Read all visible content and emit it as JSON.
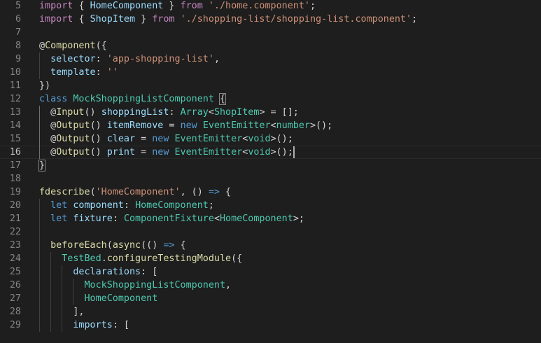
{
  "theme": {
    "keyword": "#569cd6",
    "control": "#c586c0",
    "string": "#ce9178",
    "variable": "#9cdcfe",
    "type": "#4ec9b0",
    "function": "#dcdcaa",
    "text": "#d4d4d4"
  },
  "editor": {
    "active_line": 16,
    "lines": [
      {
        "num": 5,
        "tokens": [
          [
            "import ",
            "control"
          ],
          [
            "{ ",
            "text"
          ],
          [
            "HomeComponent",
            "variable"
          ],
          [
            " } ",
            "text"
          ],
          [
            "from ",
            "control"
          ],
          [
            "'./home.component'",
            "string"
          ],
          [
            ";",
            "text"
          ]
        ]
      },
      {
        "num": 6,
        "tokens": [
          [
            "import ",
            "control"
          ],
          [
            "{ ",
            "text"
          ],
          [
            "ShopItem",
            "variable"
          ],
          [
            " } ",
            "text"
          ],
          [
            "from ",
            "control"
          ],
          [
            "'./shopping-list/shopping-list.component'",
            "string"
          ],
          [
            ";",
            "text"
          ]
        ]
      },
      {
        "num": 7,
        "tokens": []
      },
      {
        "num": 8,
        "tokens": [
          [
            "@",
            "text"
          ],
          [
            "Component",
            "function"
          ],
          [
            "({",
            "text"
          ]
        ]
      },
      {
        "num": 9,
        "tokens": [
          [
            "  ",
            "text"
          ],
          [
            "selector",
            "variable"
          ],
          [
            ": ",
            "text"
          ],
          [
            "'app-shopping-list'",
            "string"
          ],
          [
            ",",
            "text"
          ]
        ]
      },
      {
        "num": 10,
        "tokens": [
          [
            "  ",
            "text"
          ],
          [
            "template",
            "variable"
          ],
          [
            ": ",
            "text"
          ],
          [
            "''",
            "string"
          ]
        ]
      },
      {
        "num": 11,
        "tokens": [
          [
            "})",
            "text"
          ]
        ]
      },
      {
        "num": 12,
        "tokens": [
          [
            "class ",
            "keyword"
          ],
          [
            "MockShoppingListComponent",
            "type"
          ],
          [
            " ",
            "text"
          ],
          [
            "{",
            "text",
            "bm"
          ]
        ]
      },
      {
        "num": 13,
        "tokens": [
          [
            "  @",
            "text"
          ],
          [
            "Input",
            "function"
          ],
          [
            "() ",
            "text"
          ],
          [
            "shoppingList",
            "variable"
          ],
          [
            ": ",
            "text"
          ],
          [
            "Array",
            "type"
          ],
          [
            "<",
            "text"
          ],
          [
            "ShopItem",
            "type"
          ],
          [
            "> = [];",
            "text"
          ]
        ]
      },
      {
        "num": 14,
        "tokens": [
          [
            "  @",
            "text"
          ],
          [
            "Output",
            "function"
          ],
          [
            "() ",
            "text"
          ],
          [
            "itemRemove",
            "variable"
          ],
          [
            " = ",
            "text"
          ],
          [
            "new ",
            "keyword"
          ],
          [
            "EventEmitter",
            "type"
          ],
          [
            "<",
            "text"
          ],
          [
            "number",
            "type"
          ],
          [
            ">();",
            "text"
          ]
        ]
      },
      {
        "num": 15,
        "tokens": [
          [
            "  @",
            "text"
          ],
          [
            "Output",
            "function"
          ],
          [
            "() ",
            "text"
          ],
          [
            "clear",
            "variable"
          ],
          [
            " = ",
            "text"
          ],
          [
            "new ",
            "keyword"
          ],
          [
            "EventEmitter",
            "type"
          ],
          [
            "<",
            "text"
          ],
          [
            "void",
            "type"
          ],
          [
            ">();",
            "text"
          ]
        ]
      },
      {
        "num": 16,
        "tokens": [
          [
            "  @",
            "text"
          ],
          [
            "Output",
            "function"
          ],
          [
            "() ",
            "text"
          ],
          [
            "print",
            "variable"
          ],
          [
            " = ",
            "text"
          ],
          [
            "new ",
            "keyword"
          ],
          [
            "EventEmitter",
            "type"
          ],
          [
            "<",
            "text"
          ],
          [
            "void",
            "type"
          ],
          [
            ">();",
            "text"
          ]
        ]
      },
      {
        "num": 17,
        "tokens": [
          [
            "}",
            "text",
            "bm"
          ]
        ]
      },
      {
        "num": 18,
        "tokens": []
      },
      {
        "num": 19,
        "tokens": [
          [
            "fdescribe",
            "function"
          ],
          [
            "(",
            "text"
          ],
          [
            "'HomeComponent'",
            "string"
          ],
          [
            ", () ",
            "text"
          ],
          [
            "=>",
            "keyword"
          ],
          [
            " {",
            "text"
          ]
        ]
      },
      {
        "num": 20,
        "tokens": [
          [
            "  ",
            "text"
          ],
          [
            "let ",
            "keyword"
          ],
          [
            "component",
            "variable"
          ],
          [
            ": ",
            "text"
          ],
          [
            "HomeComponent",
            "type"
          ],
          [
            ";",
            "text"
          ]
        ]
      },
      {
        "num": 21,
        "tokens": [
          [
            "  ",
            "text"
          ],
          [
            "let ",
            "keyword"
          ],
          [
            "fixture",
            "variable"
          ],
          [
            ": ",
            "text"
          ],
          [
            "ComponentFixture",
            "type"
          ],
          [
            "<",
            "text"
          ],
          [
            "HomeComponent",
            "type"
          ],
          [
            ">;",
            "text"
          ]
        ]
      },
      {
        "num": 22,
        "tokens": []
      },
      {
        "num": 23,
        "tokens": [
          [
            "  ",
            "text"
          ],
          [
            "beforeEach",
            "function"
          ],
          [
            "(",
            "text"
          ],
          [
            "async",
            "function"
          ],
          [
            "(() ",
            "text"
          ],
          [
            "=>",
            "keyword"
          ],
          [
            " {",
            "text"
          ]
        ]
      },
      {
        "num": 24,
        "tokens": [
          [
            "    ",
            "text"
          ],
          [
            "TestBed",
            "type"
          ],
          [
            ".",
            "text"
          ],
          [
            "configureTestingModule",
            "function"
          ],
          [
            "({",
            "text"
          ]
        ]
      },
      {
        "num": 25,
        "tokens": [
          [
            "      ",
            "text"
          ],
          [
            "declarations",
            "variable"
          ],
          [
            ": [",
            "text"
          ]
        ]
      },
      {
        "num": 26,
        "tokens": [
          [
            "        ",
            "text"
          ],
          [
            "MockShoppingListComponent",
            "type"
          ],
          [
            ",",
            "text"
          ]
        ]
      },
      {
        "num": 27,
        "tokens": [
          [
            "        ",
            "text"
          ],
          [
            "HomeComponent",
            "type"
          ]
        ]
      },
      {
        "num": 28,
        "tokens": [
          [
            "      ],",
            "text"
          ]
        ]
      },
      {
        "num": 29,
        "tokens": [
          [
            "      ",
            "text"
          ],
          [
            "imports",
            "variable"
          ],
          [
            ": [",
            "text"
          ]
        ]
      }
    ]
  }
}
